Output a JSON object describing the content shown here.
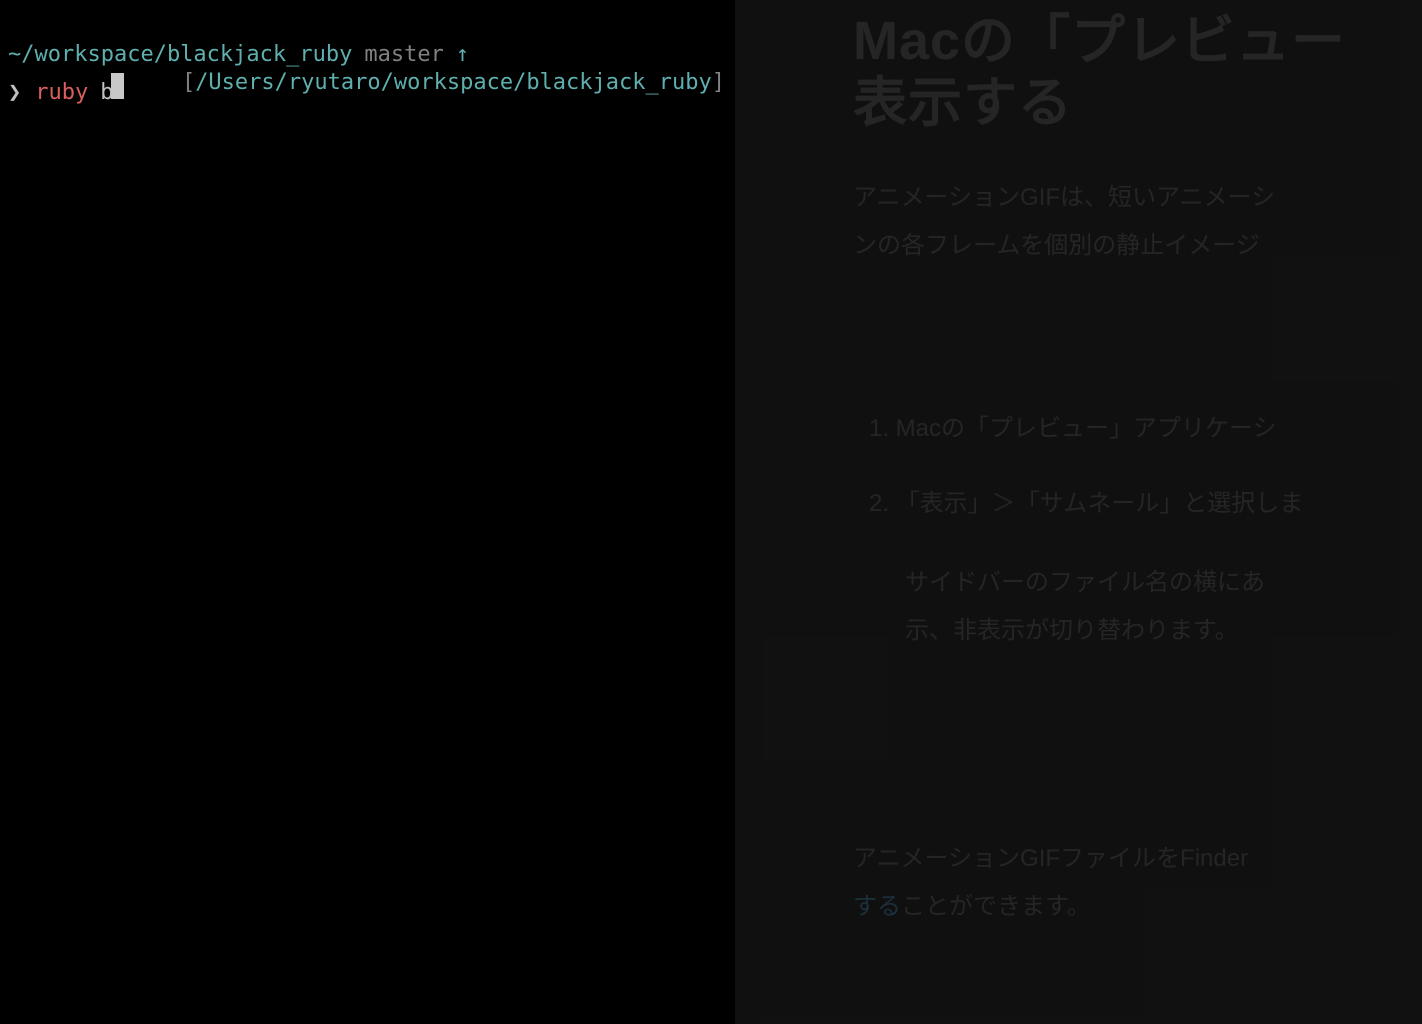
{
  "terminal": {
    "prompt": {
      "path": "~/workspace/blackjack_ruby",
      "branch": "master",
      "git_indicator": "↑"
    },
    "input": {
      "prompt_char": "❯",
      "command": "ruby",
      "arg": "b"
    },
    "rprompt": {
      "open": "[",
      "path": "/Users/ryutaro/workspace/blackjack_ruby",
      "close": "]"
    }
  },
  "background": {
    "heading_line1": "Macの「プレビュー",
    "heading_line2": "表示する",
    "para1_line1": "アニメーションGIFは、短いアニメーシ",
    "para1_line2": "ンの各フレームを個別の静止イメージ",
    "list_item1": "1. Macの「プレビュー」アプリケーシ",
    "list_item2": "2. 「表示」＞「サムネール」と選択しま",
    "list_sub_line1": "サイドバーのファイル名の横にあ",
    "list_sub_line2": "示、非表示が切り替わります。",
    "footer_line1_a": "アニメーションGIFファイルをFinder",
    "footer_line2_a": "する",
    "footer_line2_b": "ことができます。"
  }
}
